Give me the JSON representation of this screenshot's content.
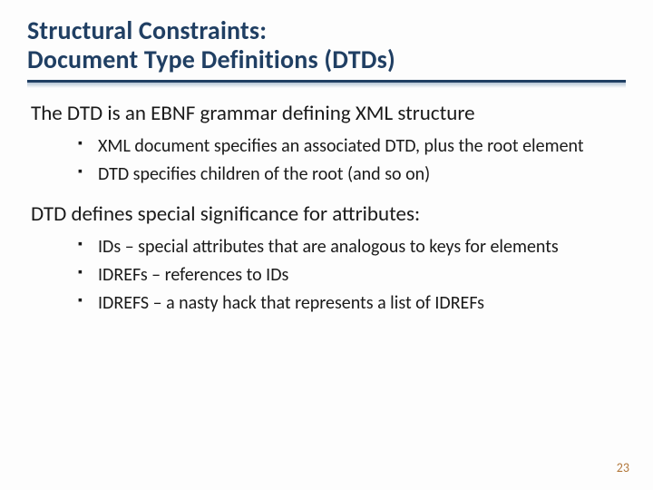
{
  "title_line1": "Structural Constraints:",
  "title_line2": "Document Type Definitions (DTDs)",
  "sections": [
    {
      "lead": "The DTD is an EBNF grammar defining XML structure",
      "bullets": [
        "XML document specifies an associated DTD, plus the root element",
        "DTD specifies children of the root (and so on)"
      ]
    },
    {
      "lead": "DTD defines special significance for attributes:",
      "bullets": [
        "IDs – special attributes that are analogous to keys for elements",
        "IDREFs – references to IDs",
        "IDREFS – a nasty hack that represents a list of IDREFs"
      ]
    }
  ],
  "page_number": "23"
}
